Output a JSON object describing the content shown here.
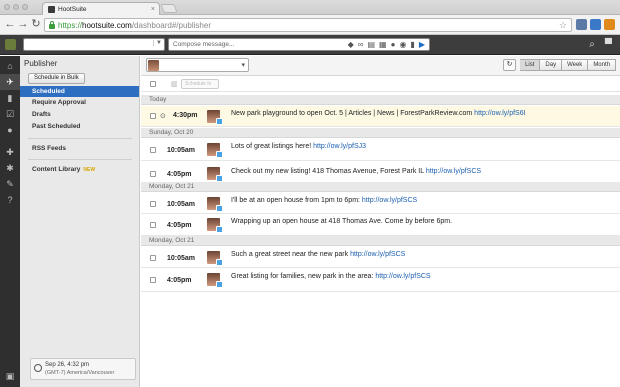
{
  "browser": {
    "tab_title": "HootSuite",
    "url_scheme": "https://",
    "url_host": "hootsuite.com",
    "url_path": "/dashboard#/publisher"
  },
  "topbar": {
    "compose_placeholder": "Compose message..."
  },
  "sidebar": {
    "title": "Publisher",
    "bulk_button": "Schedule in Bulk",
    "items": [
      {
        "label": "Scheduled"
      },
      {
        "label": "Require Approval"
      },
      {
        "label": "Drafts"
      },
      {
        "label": "Past Scheduled"
      }
    ],
    "rss": "RSS Feeds",
    "content_library": "Content Library",
    "new_badge": "NEW",
    "clock_line1": "Sep 26, 4:32 pm",
    "clock_line2": "(GMT-7) America/Vancouver"
  },
  "main": {
    "view_tabs": [
      "List",
      "Day",
      "Week",
      "Month"
    ],
    "active_view": "List",
    "schedule_button": "Schedule In",
    "groups": [
      {
        "day": "Today",
        "messages": [
          {
            "time": "4:30pm",
            "text": "New park playground to open Oct. 5 | Articles | News | ForestParkReview.com ",
            "link": "http://ow.ly/pfS6I"
          }
        ]
      },
      {
        "day": "Sunday, Oct 20",
        "messages": [
          {
            "time": "10:05am",
            "text": "Lots of great listings here! ",
            "link": "http://ow.ly/pfSJ3"
          },
          {
            "time": "4:05pm",
            "text": "Check out my new listing! 418 Thomas Avenue, Forest Park IL ",
            "link": "http://ow.ly/pfSCS"
          }
        ]
      },
      {
        "day": "Monday, Oct 21",
        "messages": [
          {
            "time": "10:05am",
            "text": "I'll be at an open house from 1pm to 6pm: ",
            "link": "http://ow.ly/pfSCS"
          },
          {
            "time": "4:05pm",
            "text": "Wrapping up an open house at 418 Thomas Ave. Come by before 6pm.",
            "link": ""
          }
        ]
      },
      {
        "day": "Monday, Oct 21",
        "messages": [
          {
            "time": "10:05am",
            "text": "Such a great street near the new park  ",
            "link": "http://ow.ly/pfSCS"
          },
          {
            "time": "4:05pm",
            "text": "Great listing for families, new park in the area: ",
            "link": "http://ow.ly/pfSCS"
          }
        ]
      }
    ]
  }
}
